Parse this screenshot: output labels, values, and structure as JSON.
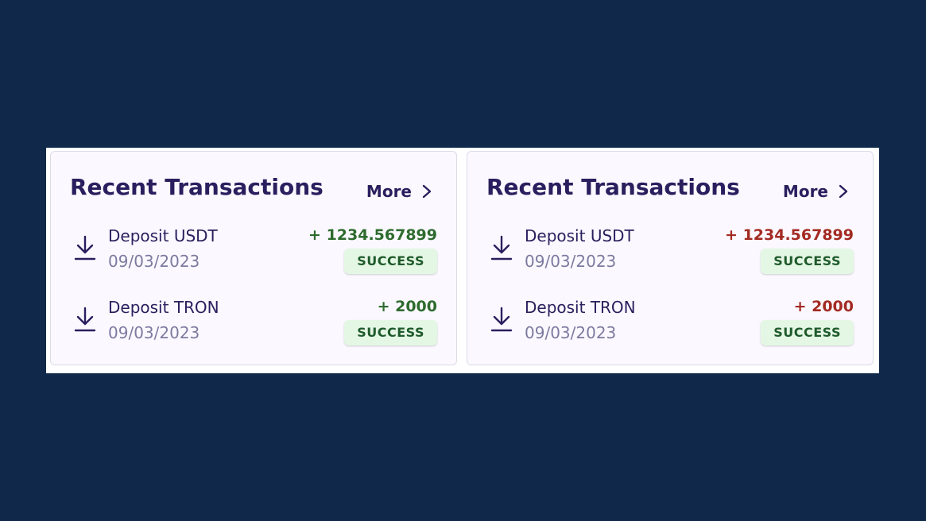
{
  "colors": {
    "background": "#10294a",
    "card": "#fbf9ff",
    "text_primary": "#2a1f5e",
    "text_secondary": "#7d7aa0",
    "amount_positive": "#2e6b2e",
    "amount_negative": "#a32a22",
    "status_bg": "#e4f7e4",
    "status_text": "#1f5a2b"
  },
  "cards": [
    {
      "title": "Recent Transactions",
      "more_label": "More",
      "amount_color": "#2e6b2e",
      "transactions": [
        {
          "name": "Deposit USDT",
          "date": "09/03/2023",
          "amount": "+ 1234.567899",
          "status": "SUCCESS",
          "icon": "download-icon"
        },
        {
          "name": "Deposit TRON",
          "date": "09/03/2023",
          "amount": "+ 2000",
          "status": "SUCCESS",
          "icon": "download-icon"
        }
      ]
    },
    {
      "title": "Recent Transactions",
      "more_label": "More",
      "amount_color": "#a32a22",
      "transactions": [
        {
          "name": "Deposit USDT",
          "date": "09/03/2023",
          "amount": "+ 1234.567899",
          "status": "SUCCESS",
          "icon": "download-icon"
        },
        {
          "name": "Deposit TRON",
          "date": "09/03/2023",
          "amount": "+ 2000",
          "status": "SUCCESS",
          "icon": "download-icon"
        }
      ]
    }
  ]
}
